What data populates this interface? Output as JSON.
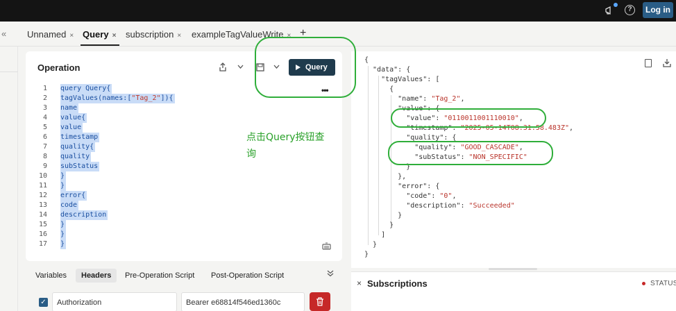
{
  "topbar": {
    "login_label": "Log in",
    "help_glyph": "?",
    "icons": [
      "megaphone-icon",
      "help-icon"
    ],
    "notification_dot_color": "#5aa7ff"
  },
  "tabs": [
    {
      "label": "Unnamed",
      "active": false
    },
    {
      "label": "Query",
      "active": true
    },
    {
      "label": "subscription",
      "active": false
    },
    {
      "label": "exampleTagValueWrite",
      "active": false
    }
  ],
  "tab_close_glyph": "×",
  "tab_add_glyph": "+",
  "collapse_glyph": "«",
  "operation": {
    "title": "Operation",
    "query_button_label": "Query",
    "more_glyph": "•••",
    "lines": [
      {
        "n": "1",
        "text": "query Query{"
      },
      {
        "n": "2",
        "text": "tagValues(names:[",
        "str": "\"Tag_2\"",
        "tail": "]){"
      },
      {
        "n": "3",
        "text": "name"
      },
      {
        "n": "4",
        "text": "value{"
      },
      {
        "n": "5",
        "text": "value"
      },
      {
        "n": "6",
        "text": "timestamp"
      },
      {
        "n": "7",
        "text": "quality{"
      },
      {
        "n": "8",
        "text": "quality"
      },
      {
        "n": "9",
        "text": "subStatus"
      },
      {
        "n": "10",
        "text": "}"
      },
      {
        "n": "11",
        "text": "}"
      },
      {
        "n": "12",
        "text": "error{"
      },
      {
        "n": "13",
        "text": "code"
      },
      {
        "n": "14",
        "text": "description"
      },
      {
        "n": "15",
        "text": "}"
      },
      {
        "n": "16",
        "text": "}"
      },
      {
        "n": "17",
        "text": "}"
      }
    ]
  },
  "annotation_note": "点击Query按钮查询",
  "bottom_tabs": {
    "variables": "Variables",
    "headers": "Headers",
    "pre_operation": "Pre-Operation Script",
    "post_operation": "Post-Operation Script"
  },
  "header_row": {
    "checked": true,
    "key": "Authorization",
    "value": "Bearer e68814f546ed1360c"
  },
  "response_lines": [
    "{",
    "  \"data\": {",
    "    \"tagValues\": [",
    "      {",
    "        \"name\": \"Tag_2\",",
    "        \"value\": {",
    "          \"value\": \"0110011001110010\",",
    "          \"timestamp\": \"2025-05-14T08:31:58.483Z\",",
    "          \"quality\": {",
    "            \"quality\": \"GOOD_CASCADE\",",
    "            \"subStatus\": \"NON_SPECIFIC\"",
    "          }",
    "        },",
    "        \"error\": {",
    "          \"code\": \"0\",",
    "          \"description\": \"Succeeded\"",
    "        }",
    "      }",
    "    ]",
    "  }",
    "}"
  ],
  "subscriptions": {
    "title": "Subscriptions",
    "status_label": "STATUS",
    "close_glyph": "×"
  },
  "colors": {
    "query_button": "#1f3b4d",
    "login_button": "#2a5d86",
    "annotation_green": "#2fae3a",
    "delete_button": "#c62828",
    "json_string": "#b9332a"
  }
}
